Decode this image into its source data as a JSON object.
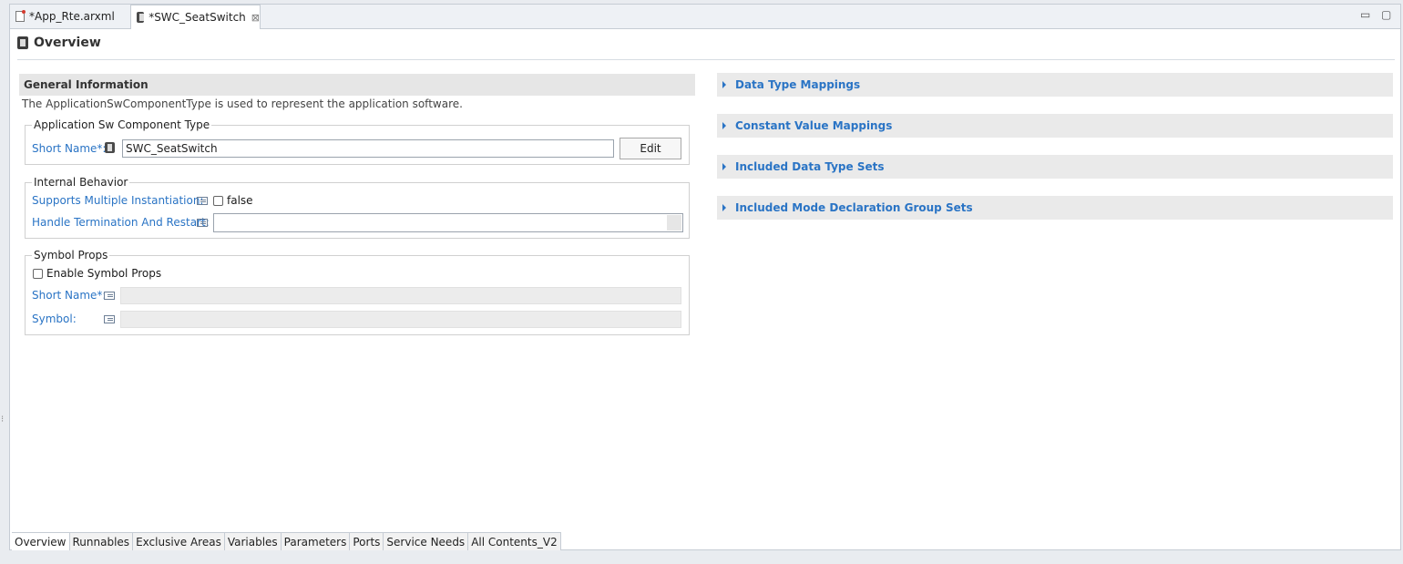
{
  "tabs": [
    {
      "label": "*App_Rte.arxml"
    },
    {
      "label": "*SWC_SeatSwitch"
    }
  ],
  "header": {
    "title": "Overview"
  },
  "general": {
    "title": "General Information",
    "description": "The ApplicationSwComponentType is used to represent the application software."
  },
  "swc": {
    "group_label": "Application Sw Component Type",
    "short_name_label": "Short Name*:",
    "short_name_value": "SWC_SeatSwitch",
    "edit_label": "Edit"
  },
  "internal": {
    "group_label": "Internal Behavior",
    "multi_inst_label": "Supports Multiple Instantiation:",
    "multi_inst_value": "false",
    "handle_term_label": "Handle Termination And Restart:"
  },
  "symbol": {
    "group_label": "Symbol Props",
    "enable_label": "Enable Symbol Props",
    "short_name_label": "Short Name*:",
    "symbol_label": "Symbol:"
  },
  "sections": [
    {
      "label": "Data Type Mappings"
    },
    {
      "label": "Constant Value Mappings"
    },
    {
      "label": "Included Data Type Sets"
    },
    {
      "label": "Included Mode Declaration Group Sets"
    }
  ],
  "page_tabs": [
    {
      "label": "Overview"
    },
    {
      "label": "Runnables"
    },
    {
      "label": "Exclusive Areas"
    },
    {
      "label": "Variables"
    },
    {
      "label": "Parameters"
    },
    {
      "label": "Ports"
    },
    {
      "label": "Service Needs"
    },
    {
      "label": "All Contents_V2"
    }
  ],
  "window": {
    "minimize_glyph": "▭",
    "maximize_glyph": "▢"
  }
}
